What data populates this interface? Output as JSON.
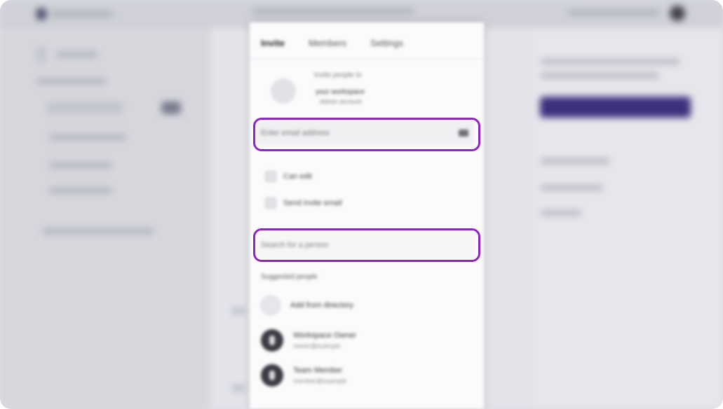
{
  "panel": {
    "tabs": [
      {
        "label": "Invite"
      },
      {
        "label": "Members"
      },
      {
        "label": "Settings"
      }
    ],
    "org": {
      "line1": "Invite people to",
      "line2": "your workspace",
      "line3": "Admin account"
    },
    "email_field": {
      "placeholder": "Enter email address",
      "badge": ""
    },
    "options": [
      {
        "label": "Can edit"
      },
      {
        "label": "Send invite email"
      }
    ],
    "link_field": {
      "placeholder": "Search for a person"
    },
    "section_label": "Suggested people",
    "list": [
      {
        "title": "Add from directory",
        "sub": ""
      },
      {
        "title": "Workspace Owner",
        "sub": "owner@example"
      },
      {
        "title": "Team Member",
        "sub": "member@example"
      }
    ]
  },
  "colors": {
    "highlight": "#8e24c4",
    "primary_button": "#3d2f7d"
  }
}
